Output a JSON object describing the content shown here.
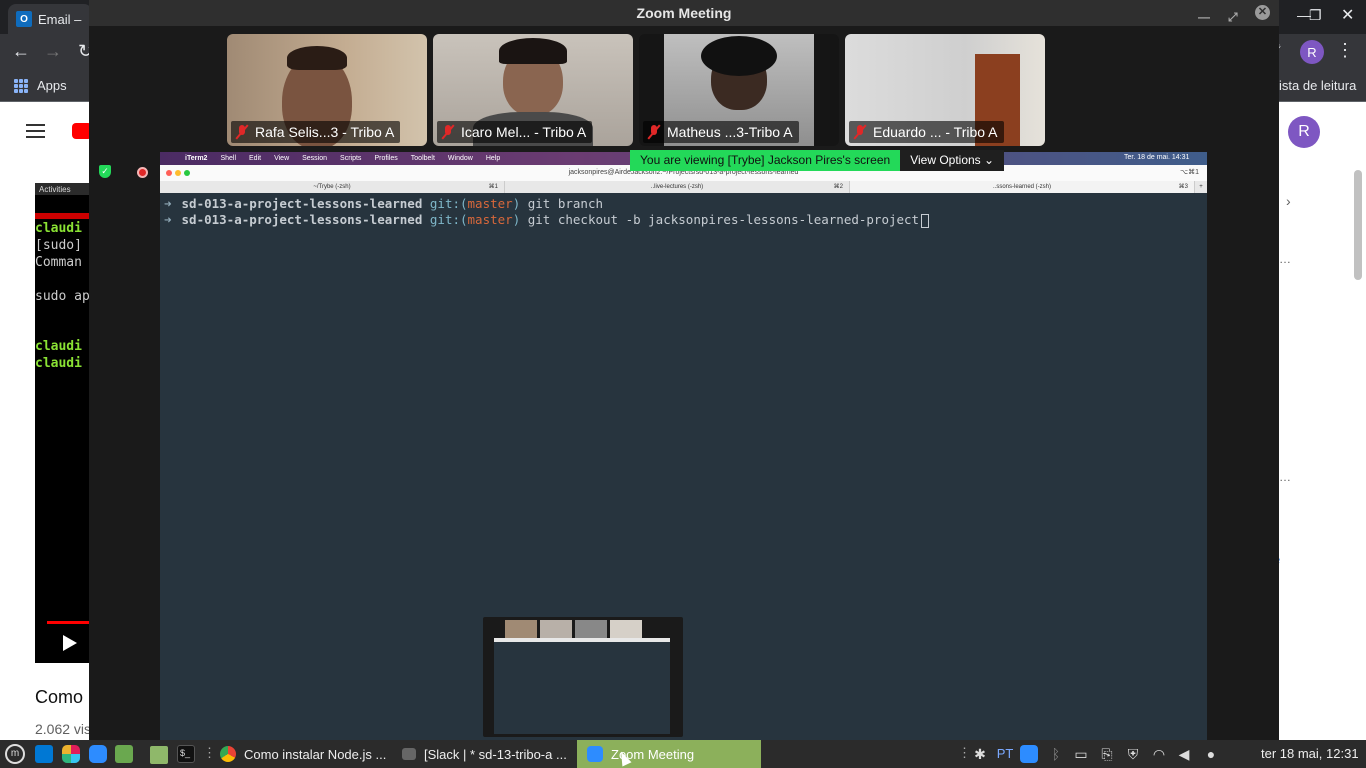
{
  "chrome": {
    "tab_title": "Email –",
    "bookmarks": {
      "apps_label": "Apps",
      "reading_list": "ista de leitura"
    },
    "profile_initial": "R",
    "youtube": {
      "video_title_partial": "Como",
      "views_partial": "2.062 vis",
      "terminal_lines": [
        "claudi",
        "[sudo]",
        "Comman",
        "sudo ap",
        "claudi",
        "claudi"
      ],
      "activities_label": "Activities"
    }
  },
  "zoom": {
    "window_title": "Zoom Meeting",
    "participants": [
      {
        "name": "Rafa Selis...3 - Tribo A",
        "muted": true
      },
      {
        "name": "Icaro Mel... - Tribo A",
        "muted": true
      },
      {
        "name": "Matheus ...3-Tribo A",
        "muted": true
      },
      {
        "name": "Eduardo  ... - Tribo A",
        "muted": true
      }
    ],
    "banner_text": "You are viewing [Trybe] Jackson Pires's screen",
    "view_options_label": "View Options",
    "shared_screen": {
      "menubar": [
        "iTerm2",
        "Shell",
        "Edit",
        "View",
        "Session",
        "Scripts",
        "Profiles",
        "Toolbelt",
        "Window",
        "Help"
      ],
      "menubar_right": "Ter. 18 de mai. 14:31",
      "window_title": "jacksonpires@AirdeJackson2:~/Projects/sd-013-a-project-lessons-learned",
      "shortcut_right": "⌥⌘1",
      "tabs": [
        {
          "label": "~/Trybe (-zsh)",
          "key": "⌘1"
        },
        {
          "label": "..live-lectures (-zsh)",
          "key": "⌘2"
        },
        {
          "label": "..ssons-learned (-zsh)",
          "key": "⌘3"
        }
      ],
      "terminal": [
        {
          "arrow": "➜",
          "dir": "sd-013-a-project-lessons-learned",
          "git_prefix": "git:(",
          "branch": "master",
          "git_suffix": ")",
          "command": "git branch"
        },
        {
          "arrow": "➜",
          "dir": "sd-013-a-project-lessons-learned",
          "git_prefix": "git:(",
          "branch": "master",
          "git_suffix": ")",
          "command": "git checkout -b jacksonpires-lessons-learned-project"
        }
      ]
    }
  },
  "taskbar": {
    "tasks": [
      {
        "label": "Como instalar Node.js ...",
        "active": false
      },
      {
        "label": "[Slack | * sd-13-tribo-a ...",
        "active": false
      },
      {
        "label": "Zoom Meeting",
        "active": true
      }
    ],
    "language": "PT",
    "clock": "ter 18 mai, 12:31"
  },
  "colors": {
    "zoom_banner": "#23d959",
    "taskbar_active": "#8cb05b",
    "muted_red": "#e02828",
    "terminal_bg": "#27343e"
  }
}
